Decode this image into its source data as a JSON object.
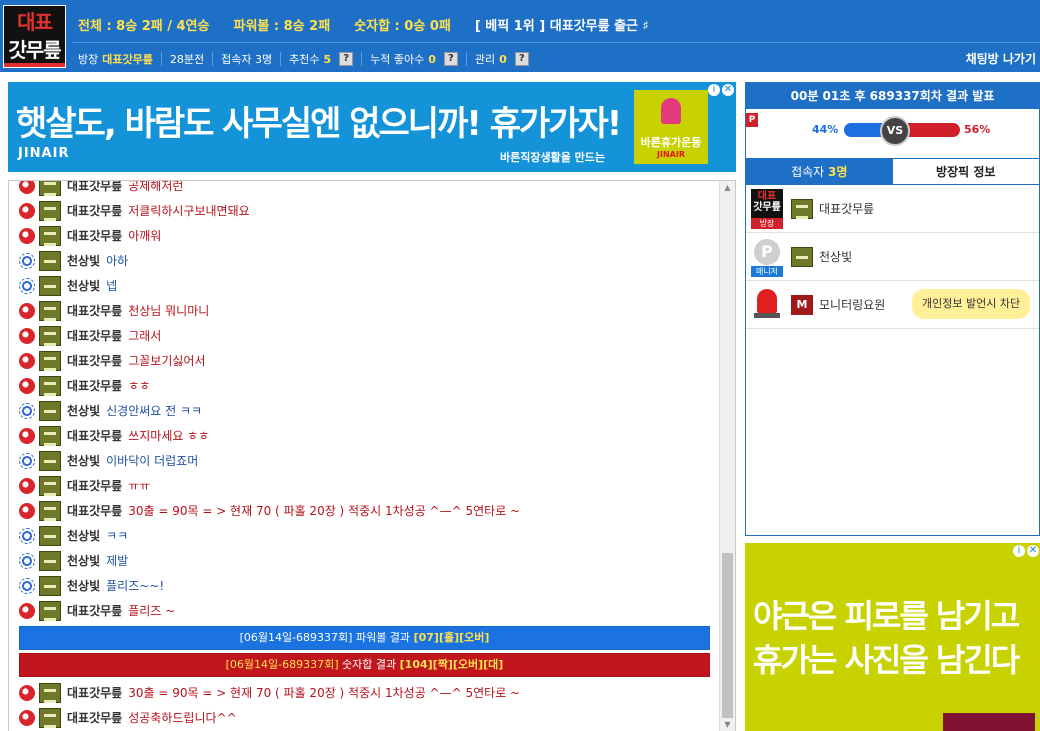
{
  "header": {
    "logo_line1": "대표",
    "logo_line2": "갓무릎",
    "stats": {
      "overall": "전체 : 8승 2패 / 4연승",
      "powerball": "파워볼 : 8승 2패",
      "sum": "숫자합 : 0승 0패",
      "rank": "[ 베픽 1위 ] 대표갓무릎 출근 ♯"
    },
    "info": {
      "host_label": "방장",
      "host_value": "대표갓무릎",
      "elapsed": "28분전",
      "users_label": "접속자",
      "users_value": "3명",
      "recommend_label": "추천수",
      "recommend_value": "5",
      "likes_label": "누적 좋아수",
      "likes_value": "0",
      "manage_label": "관리",
      "manage_value": "0",
      "help": "?"
    },
    "exit_label": "채팅방 나가기"
  },
  "top_ad": {
    "headline": "햇살도, 바람도 사무실엔 없으니까! 휴가가자!",
    "brand": "JINAIR",
    "sub": "바른직장생활을 만드는",
    "badge": "바른휴가운동",
    "badge_small": "JINAIR",
    "info_icon": "i",
    "close_icon": "✕"
  },
  "chat": {
    "messages": [
      {
        "grade": "red",
        "level": "bars",
        "nick": "대표갓무릎",
        "text": "공제해저런",
        "color": "red"
      },
      {
        "grade": "red",
        "level": "bars",
        "nick": "대표갓무릎",
        "text": "저클릭하시구보내면돼요",
        "color": "red"
      },
      {
        "grade": "red",
        "level": "bars",
        "nick": "대표갓무릎",
        "text": "아깨워",
        "color": "red"
      },
      {
        "grade": "blue",
        "level": "plain",
        "nick": "천상빛",
        "text": "아하",
        "color": "blue"
      },
      {
        "grade": "blue",
        "level": "plain",
        "nick": "천상빛",
        "text": "넵",
        "color": "blue"
      },
      {
        "grade": "red",
        "level": "bars",
        "nick": "대표갓무릎",
        "text": "천상님 뭐니마니",
        "color": "red"
      },
      {
        "grade": "red",
        "level": "bars",
        "nick": "대표갓무릎",
        "text": "그래서",
        "color": "red"
      },
      {
        "grade": "red",
        "level": "bars",
        "nick": "대표갓무릎",
        "text": "그꼴보기싫어서",
        "color": "red"
      },
      {
        "grade": "red",
        "level": "bars",
        "nick": "대표갓무릎",
        "text": "ㅎㅎ",
        "color": "red"
      },
      {
        "grade": "blue",
        "level": "plain",
        "nick": "천상빛",
        "text": "신경안써요 전 ㅋㅋ",
        "color": "blue"
      },
      {
        "grade": "red",
        "level": "bars",
        "nick": "대표갓무릎",
        "text": "쓰지마세요 ㅎㅎ",
        "color": "red"
      },
      {
        "grade": "blue",
        "level": "plain",
        "nick": "천상빛",
        "text": "이바닥이 더럽죠머",
        "color": "blue"
      },
      {
        "grade": "red",
        "level": "bars",
        "nick": "대표갓무릎",
        "text": "ㅠㅠ",
        "color": "red"
      },
      {
        "grade": "red",
        "level": "bars",
        "nick": "대표갓무릎",
        "text": "30출 = 90목 = > 현재 70 ( 파홀 20장 ) 적중시 1차성공 ^—^ 5연타로 ~",
        "color": "red"
      },
      {
        "grade": "blue",
        "level": "plain",
        "nick": "천상빛",
        "text": "ㅋㅋ",
        "color": "blue"
      },
      {
        "grade": "blue",
        "level": "plain",
        "nick": "천상빛",
        "text": "제발",
        "color": "blue"
      },
      {
        "grade": "blue",
        "level": "plain",
        "nick": "천상빛",
        "text": "플리즈~~!",
        "color": "blue"
      },
      {
        "grade": "red",
        "level": "bars",
        "nick": "대표갓무릎",
        "text": "플리즈 ~",
        "color": "red"
      }
    ],
    "sys_powerball": {
      "prefix": "[06월14일-689337회] 파워볼 결과 ",
      "r1": "[07]",
      "r2": "[홀]",
      "r3": "[오버]"
    },
    "sys_sum": {
      "prefix": "[06월14일-689337회]",
      "mid": " 숫자합 결과 ",
      "r1": "[104]",
      "r2": "[짝]",
      "r3": "[오버]",
      "r4": "[대]"
    },
    "tail_messages": [
      {
        "grade": "red",
        "level": "bars",
        "nick": "대표갓무릎",
        "text": "30출 = 90목 = > 현재 70 ( 파홀 20장 ) 적중시 1차성공 ^—^ 5연타로 ~",
        "color": "red"
      },
      {
        "grade": "red",
        "level": "bars",
        "nick": "대표갓무릎",
        "text": "성공축하드립니다^^",
        "color": "red"
      }
    ],
    "scroll_up": "▲",
    "scroll_down": "▼"
  },
  "round": {
    "title": "00분 01초 후 689337회차 결과 발표",
    "p_tag": "P",
    "left_pct": "44%",
    "right_pct": "56%",
    "vs": "VS",
    "left_color": "#1b6fe0",
    "right_color": "#d0202a"
  },
  "users_panel": {
    "tab_users_label": "접속자",
    "tab_users_count": "3명",
    "tab_info_label": "방장픽 정보",
    "users": [
      {
        "name": "대표갓무릎",
        "role": "방장",
        "avatar": "logo",
        "level": "bars"
      },
      {
        "name": "천상빛",
        "role": "매니저",
        "avatar": "p",
        "level": "plain",
        "avatar_letter": "P"
      },
      {
        "name": "모니터링요원",
        "role": "",
        "avatar": "siren",
        "level": "m",
        "level_letter": "M"
      }
    ],
    "avatar_logo_l1": "대표",
    "avatar_logo_l2": "갓무릎",
    "tooltip": "개인정보 발언시 차단"
  },
  "side_ad": {
    "line1": "야근은 피로를 남기고",
    "line2": "휴가는 사진을 남긴다",
    "info_icon": "i",
    "close_icon": "✕"
  }
}
